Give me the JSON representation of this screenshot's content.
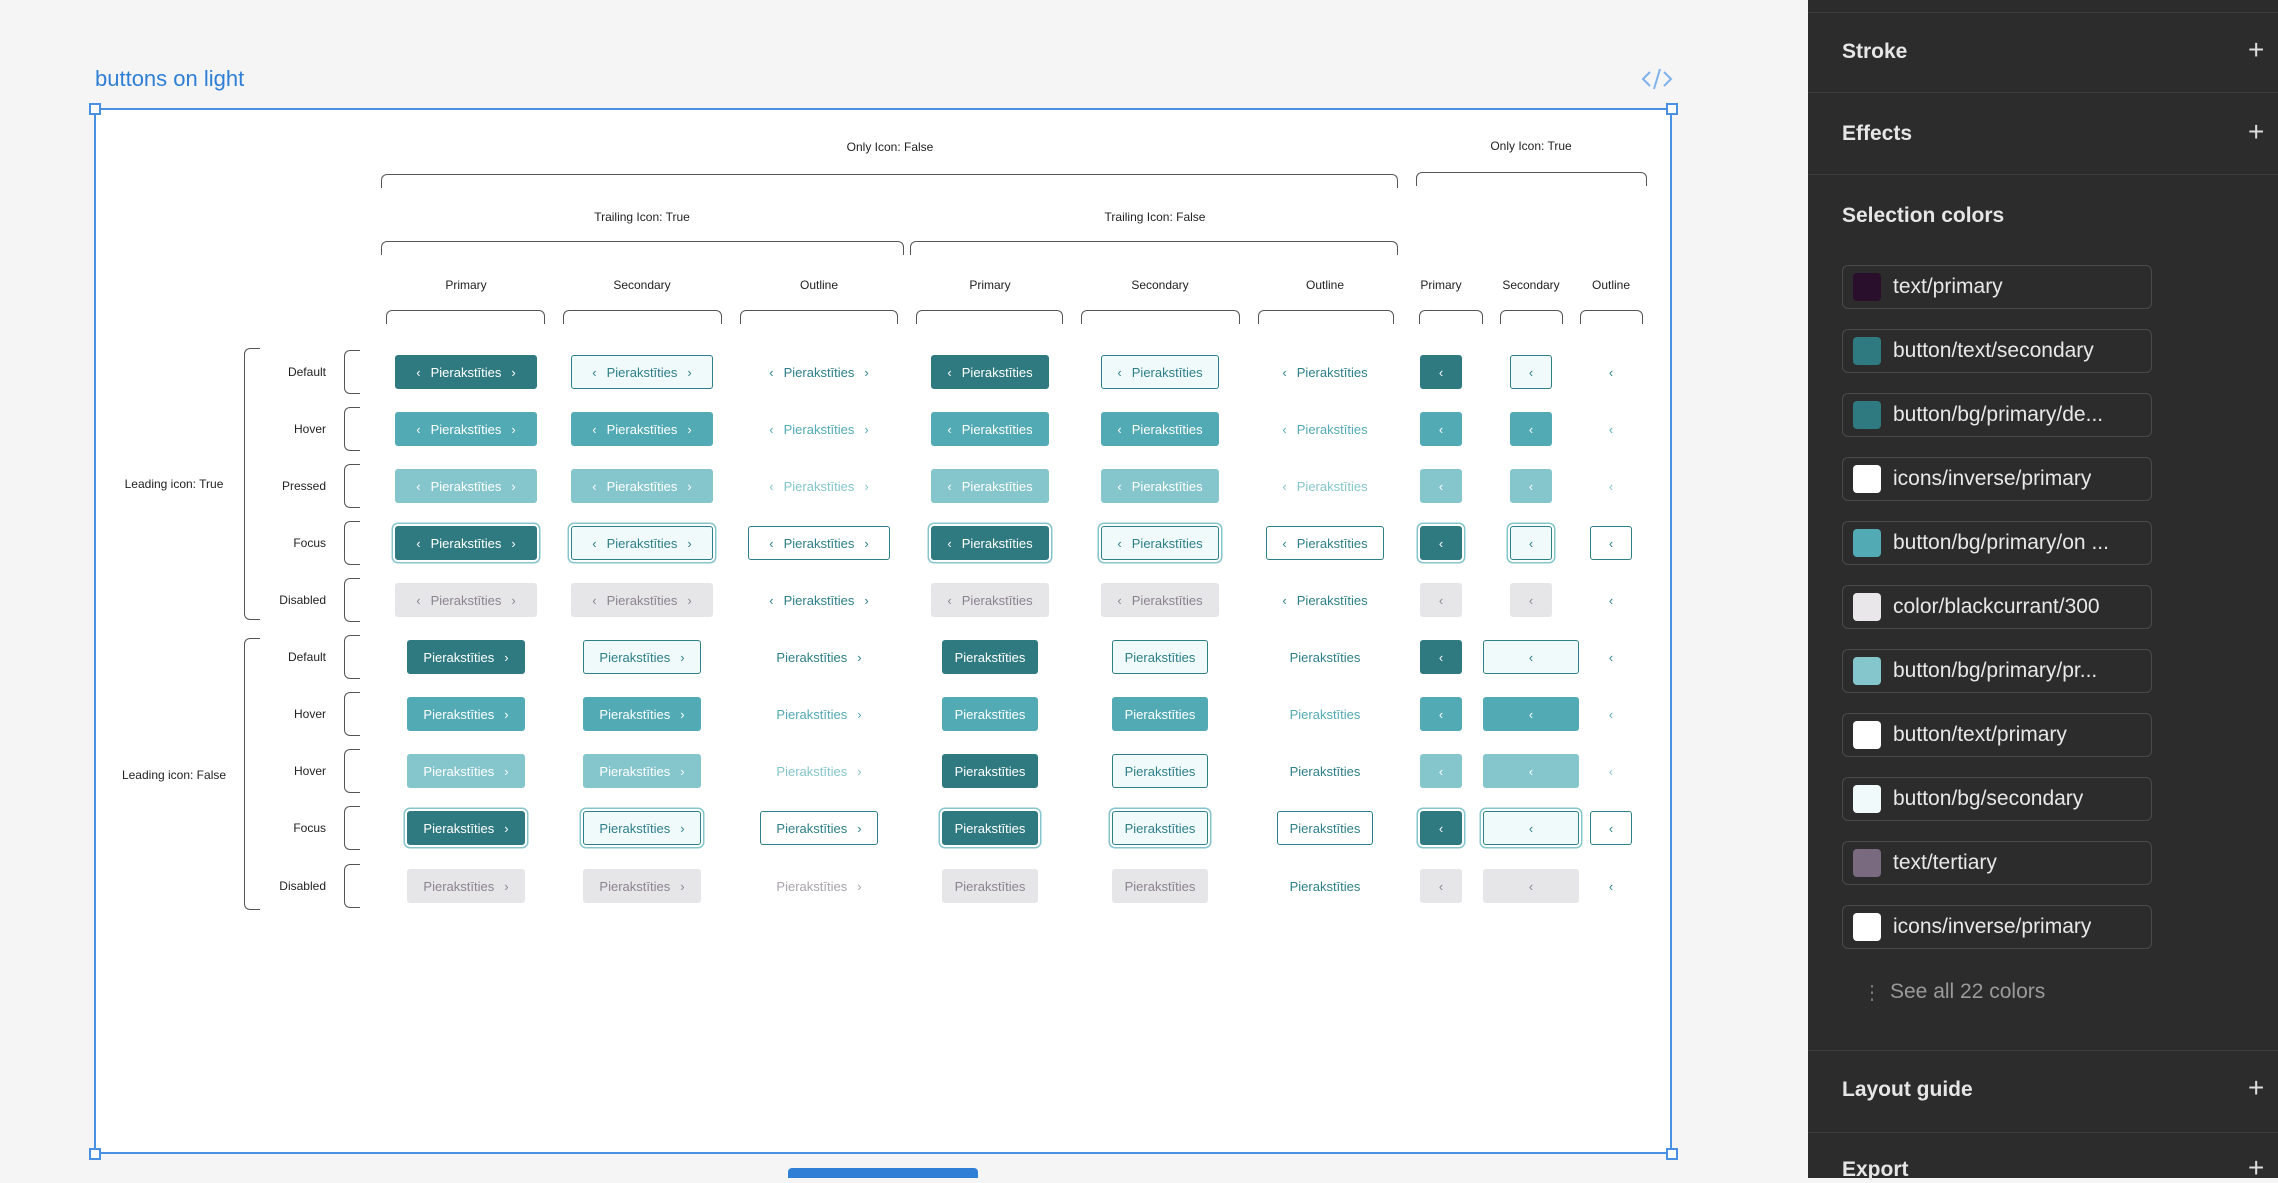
{
  "frame": {
    "title": "buttons on light"
  },
  "headers": {
    "only_icon_false": "Only Icon: False",
    "only_icon_true": "Only Icon: True",
    "trailing_true": "Trailing Icon: True",
    "trailing_false": "Trailing Icon: False",
    "variants": [
      "Primary",
      "Secondary",
      "Outline",
      "Primary",
      "Secondary",
      "Outline",
      "Primary",
      "Secondary",
      "Outline"
    ],
    "leading_true": "Leading icon: True",
    "leading_false": "Leading icon: False"
  },
  "states_group1": [
    "Default",
    "Hover",
    "Pressed",
    "Focus",
    "Disabled"
  ],
  "states_group2": [
    "Default",
    "Hover",
    "Hover",
    "Focus",
    "Disabled"
  ],
  "button_label": "Pierakstīties",
  "icons": {
    "leading": "chevron-left-icon",
    "trailing": "chevron-right-icon",
    "code": "code-icon"
  },
  "colors": {
    "primary_default": "#2f7a80",
    "primary_hover": "#52aab4",
    "primary_pressed": "#85c6cd",
    "secondary_bg": "#f1fafb",
    "teal_text": "#2d7f88",
    "disabled_bg": "#e6e5e8",
    "disabled_text": "#8a8490",
    "selection_blue": "#4a90e2"
  },
  "panel": {
    "stroke": "Stroke",
    "effects": "Effects",
    "selection_colors": "Selection colors",
    "colors": [
      {
        "name": "text/primary",
        "hex": "#2a0f2c"
      },
      {
        "name": "button/text/secondary",
        "hex": "#2f7a80"
      },
      {
        "name": "button/bg/primary/de...",
        "hex": "#2f7a80"
      },
      {
        "name": "icons/inverse/primary",
        "hex": "#ffffff"
      },
      {
        "name": "button/bg/primary/on ...",
        "hex": "#52aab4"
      },
      {
        "name": "color/blackcurrant/300",
        "hex": "#e9e7ea"
      },
      {
        "name": "button/bg/primary/pr...",
        "hex": "#85c6cd"
      },
      {
        "name": "button/text/primary",
        "hex": "#ffffff"
      },
      {
        "name": "button/bg/secondary",
        "hex": "#f1fafb"
      },
      {
        "name": "text/tertiary",
        "hex": "#7a6a80"
      },
      {
        "name": "icons/inverse/primary",
        "hex": "#ffffff"
      }
    ],
    "see_all": "See all 22 colors",
    "layout_guide": "Layout guide",
    "export": "Export"
  }
}
